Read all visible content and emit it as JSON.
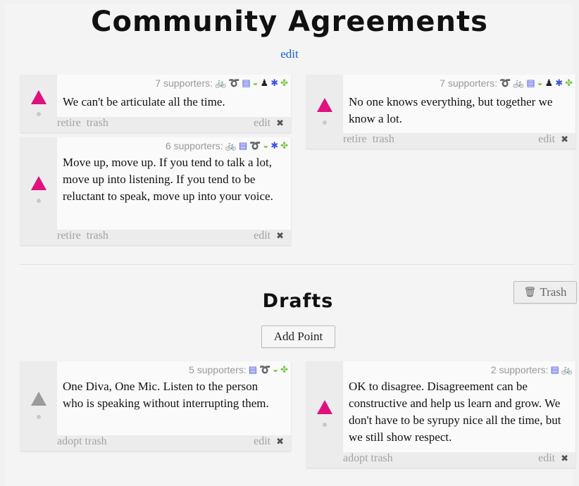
{
  "header": {
    "title": "Community Agreements",
    "edit_label": "edit"
  },
  "agreements": [
    {
      "supporters": "7 supporters:",
      "icons": [
        "bike-icon",
        "paperclip-icon",
        "book-icon",
        "mask-icon",
        "person-icon",
        "bug-icon",
        "paw-icon"
      ],
      "text": "We can't be articulate all the time.",
      "actions": {
        "retire": "retire",
        "trash": "trash",
        "edit": "edit"
      }
    },
    {
      "supporters": "6 supporters:",
      "icons": [
        "bike-icon",
        "book-icon",
        "paperclip-icon",
        "mask-icon",
        "bug-icon",
        "paw-icon"
      ],
      "text": "Move up, move up. If you tend to talk a lot, move up into listening. If you tend to be reluctant to speak, move up into your voice.",
      "actions": {
        "retire": "retire",
        "trash": "trash",
        "edit": "edit"
      }
    },
    {
      "supporters": "7 supporters:",
      "icons": [
        "paperclip-icon",
        "bike-icon",
        "book-icon",
        "mask-icon",
        "person-icon",
        "bug-icon",
        "paw-icon"
      ],
      "text": "No one knows everything, but together we know a lot.",
      "actions": {
        "retire": "retire",
        "trash": "trash",
        "edit": "edit"
      }
    }
  ],
  "drafts_section": {
    "title": "Drafts",
    "trash_button": "Trash",
    "add_point_button": "Add Point"
  },
  "drafts": [
    {
      "supporters": "5 supporters:",
      "icons": [
        "book-icon",
        "paperclip-icon",
        "mask-icon",
        "paw-icon"
      ],
      "text": "One Diva, One Mic. Listen to the person who is speaking without interrupting them.",
      "actions": {
        "adopt": "adopt",
        "trash": "trash",
        "edit": "edit"
      }
    },
    {
      "supporters": "2 supporters:",
      "icons": [
        "book-icon",
        "bike-icon"
      ],
      "text": "OK to disagree. Disagreement can be constructive and help us learn and grow. We don't have to be syrupy nice all the time, but we still show respect.",
      "actions": {
        "adopt": "adopt",
        "trash": "trash",
        "edit": "edit"
      }
    }
  ],
  "colors": {
    "vote_active": "#e0107f",
    "vote_inactive": "#9b9b9b",
    "link": "#1a5fd8"
  }
}
